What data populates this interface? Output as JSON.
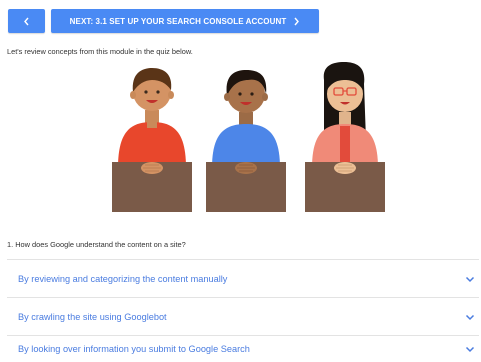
{
  "nav": {
    "prev_icon": "chevron-left-icon",
    "next_label": "NEXT: 3.1 SET UP YOUR SEARCH CONSOLE ACCOUNT",
    "next_icon": "chevron-right-icon",
    "button_color": "#4a8af4"
  },
  "intro": {
    "text": "Let's review concepts from this module in the quiz below."
  },
  "illustration": {
    "description_icon": "three-people-at-desks-illustration"
  },
  "quiz": {
    "question": "1. How does Google understand the content on a site?",
    "answers": [
      {
        "label": "By reviewing and categorizing the content manually",
        "icon": "chevron-down-icon"
      },
      {
        "label": "By crawling the site using Googlebot",
        "icon": "chevron-down-icon"
      },
      {
        "label": "By looking over information you submit to Google Search",
        "icon": "chevron-down-icon"
      }
    ],
    "answer_color": "#4a7ce0"
  }
}
